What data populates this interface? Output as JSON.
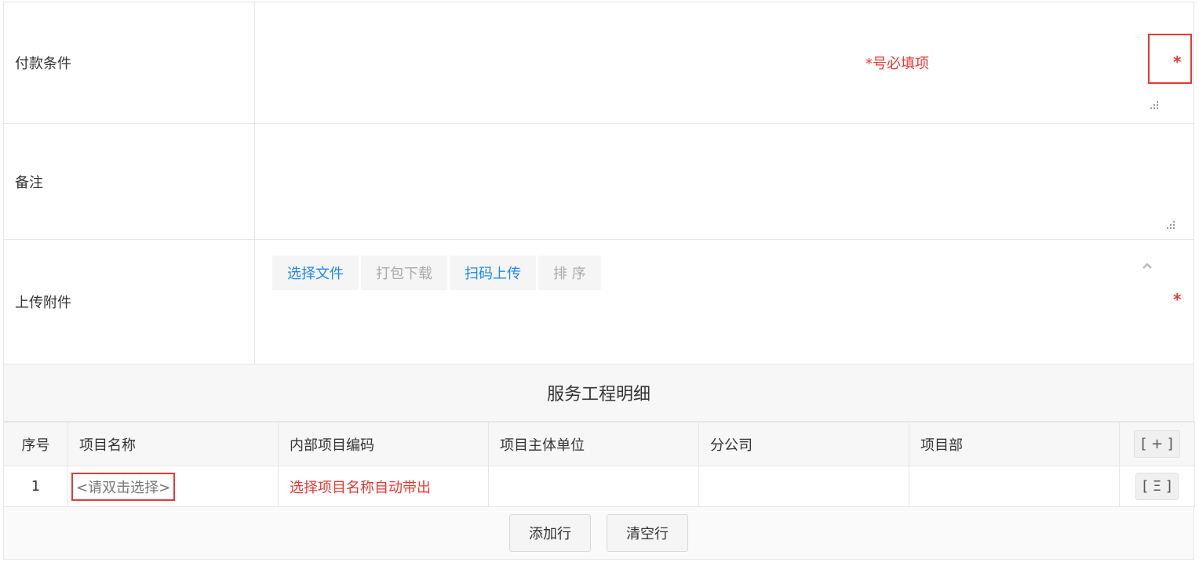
{
  "form": {
    "payment_terms_label": "付款条件",
    "required_hint": "*号必填项",
    "required_mark": "*",
    "remarks_label": "备注",
    "upload_label": "上传附件",
    "upload_buttons": {
      "choose_file": "选择文件",
      "pack_download": "打包下载",
      "scan_upload": "扫码上传",
      "sort": "排 序"
    }
  },
  "detail": {
    "section_title": "服务工程明细",
    "columns": [
      "序号",
      "项目名称",
      "内部项目编码",
      "项目主体单位",
      "分公司",
      "项目部"
    ],
    "add_column_button": "[ + ]",
    "rows": [
      {
        "index": "1",
        "project_name_placeholder": "<请双击选择>",
        "internal_code_hint": "选择项目名称自动带出",
        "row_menu_button": "[ Ξ ]"
      }
    ],
    "add_row_button": "添加行",
    "clear_rows_button": "清空行"
  },
  "colors": {
    "required_red": "#e53935",
    "link_blue": "#1e88e5"
  }
}
